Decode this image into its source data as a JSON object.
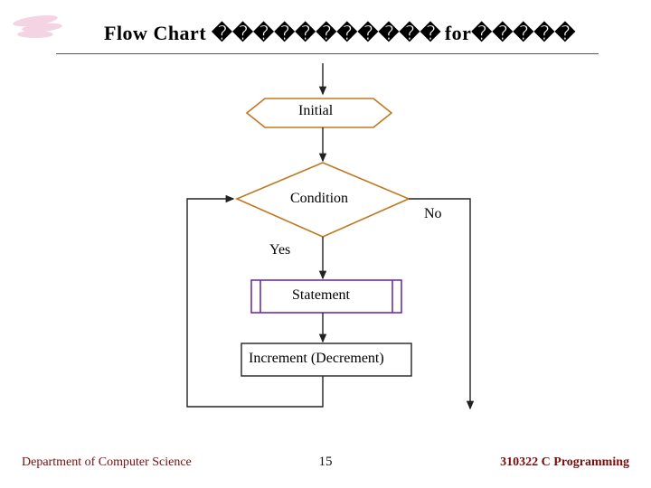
{
  "header": {
    "title_prefix": "Flow Chart",
    "title_boxes": "�����������",
    "keyword": "for",
    "title_boxes_tail": "�����"
  },
  "nodes": {
    "initial": "Initial",
    "condition": "Condition",
    "statement": "Statement",
    "increment": "Increment (Decrement)"
  },
  "edges": {
    "yes": "Yes",
    "no": "No"
  },
  "footer": {
    "left": "Department of Computer Science",
    "page": "15",
    "right": "310322 C Programming"
  },
  "colors": {
    "preparation": "#c07820",
    "decision": "#c07820",
    "statement_border": "#6a2fb0",
    "increment_border": "#222",
    "arrow": "#222"
  }
}
